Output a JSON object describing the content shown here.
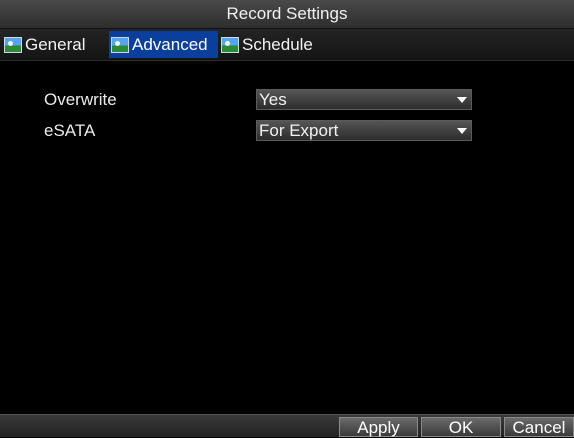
{
  "window": {
    "title": "Record Settings"
  },
  "tabs": [
    {
      "label": "General",
      "icon": "picture-icon",
      "active": false
    },
    {
      "label": "Advanced",
      "icon": "picture-icon",
      "active": true
    },
    {
      "label": "Schedule",
      "icon": "picture-icon",
      "active": false
    }
  ],
  "settings": [
    {
      "label": "Overwrite",
      "value": "Yes"
    },
    {
      "label": "eSATA",
      "value": "For Export"
    }
  ],
  "buttons": {
    "apply": "Apply",
    "ok": "OK",
    "cancel": "Cancel"
  },
  "colors": {
    "active_tab": "#0b3f9e",
    "background": "#000000"
  }
}
